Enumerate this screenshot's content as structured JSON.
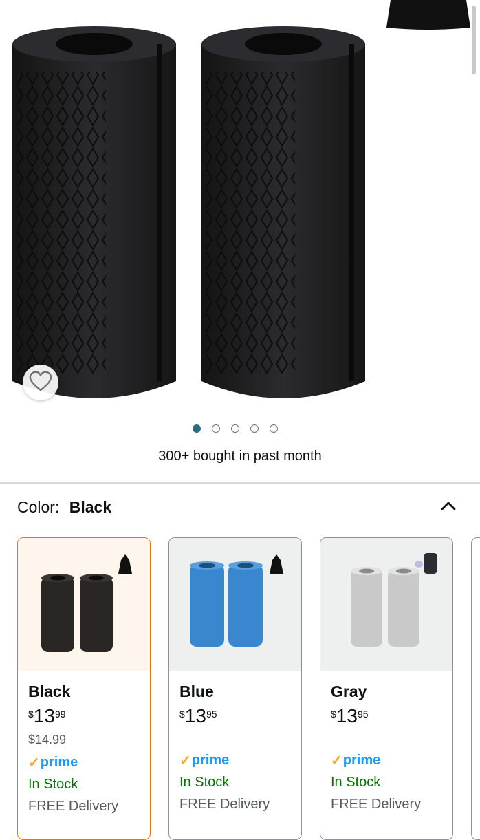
{
  "gallery": {
    "image_count": 5,
    "active_index": 0,
    "bought_text": "300+ bought in past month"
  },
  "color": {
    "label": "Color:",
    "selected": "Black"
  },
  "variants": [
    {
      "name": "Black",
      "price_symbol": "$",
      "price_whole": "13",
      "price_fraction": "99",
      "list_price": "$14.99",
      "prime": "prime",
      "stock": "In Stock",
      "delivery": "FREE Delivery",
      "swatch": "#2a2624"
    },
    {
      "name": "Blue",
      "price_symbol": "$",
      "price_whole": "13",
      "price_fraction": "95",
      "prime": "prime",
      "stock": "In Stock",
      "delivery": "FREE Delivery",
      "swatch": "#3a86cf"
    },
    {
      "name": "Gray",
      "price_symbol": "$",
      "price_whole": "13",
      "price_fraction": "95",
      "prime": "prime",
      "stock": "In Stock",
      "delivery": "FREE Delivery",
      "swatch": "#c9c9c9"
    }
  ],
  "colors": {
    "accent_selected": "#e77600",
    "prime_blue": "#1a98ff",
    "in_stock_green": "#007600",
    "dot_active": "#2e6b7e"
  },
  "icons": [
    "heart-icon",
    "chevron-up-icon",
    "prime-check-icon"
  ]
}
